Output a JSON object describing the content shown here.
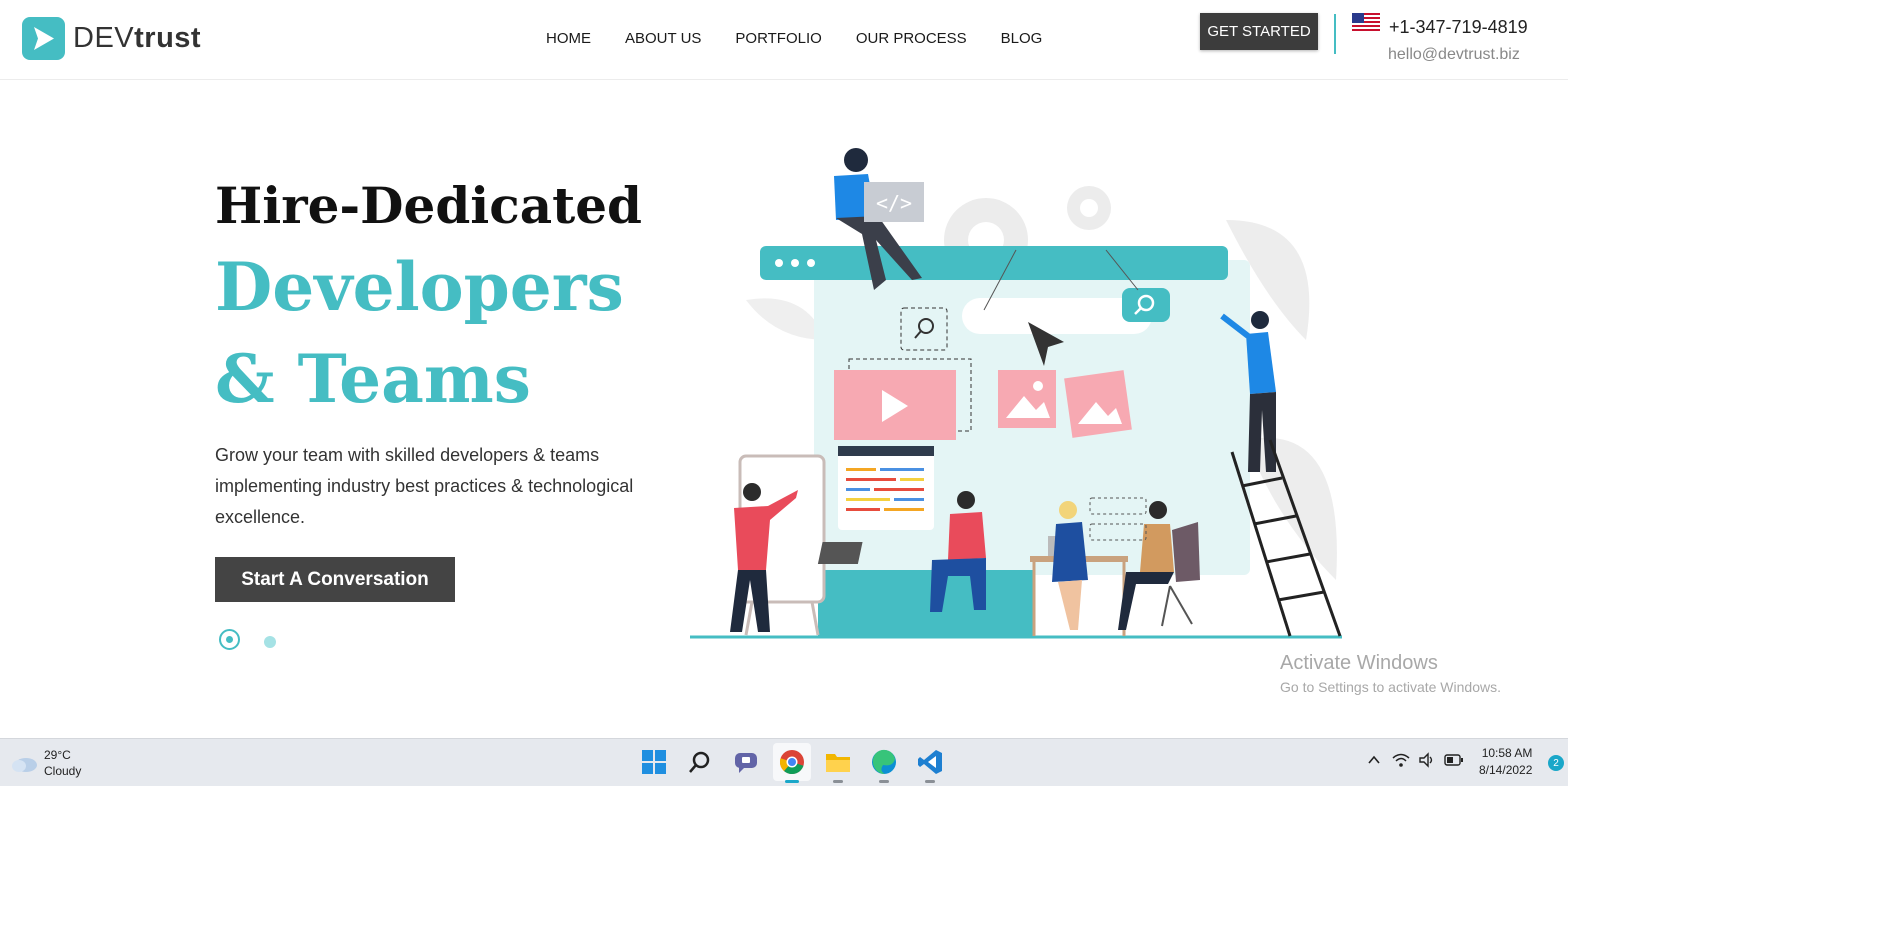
{
  "header": {
    "logo_prefix": "DEV",
    "logo_suffix": "trust",
    "nav": [
      "HOME",
      "ABOUT US",
      "PORTFOLIO",
      "OUR PROCESS",
      "BLOG"
    ],
    "cta_label": "GET STARTED",
    "phone": "+1-347-719-4819",
    "email": "hello@devtrust.biz"
  },
  "hero": {
    "title_line1": "Hire-Dedicated",
    "title_line2": "Developers",
    "title_line3": "& Teams",
    "description": "Grow your team with skilled developers & teams implementing industry best practices & technological excellence.",
    "button_label": "Start A Conversation",
    "slides_total": 2,
    "slide_active": 1,
    "illustration_code_label": "</>"
  },
  "watermark": {
    "title": "Activate Windows",
    "subtitle": "Go to Settings to activate Windows."
  },
  "taskbar": {
    "weather_temp": "29°C",
    "weather_cond": "Cloudy",
    "apps": [
      "start-icon",
      "search-icon",
      "teams-chat-icon",
      "chrome-icon",
      "file-explorer-icon",
      "edge-icon",
      "vscode-icon"
    ],
    "time": "10:58 AM",
    "date": "8/14/2022",
    "notification_count": "2"
  },
  "colors": {
    "accent": "#45bdc3",
    "dark_button": "#444444",
    "pink": "#f7a9b2"
  }
}
